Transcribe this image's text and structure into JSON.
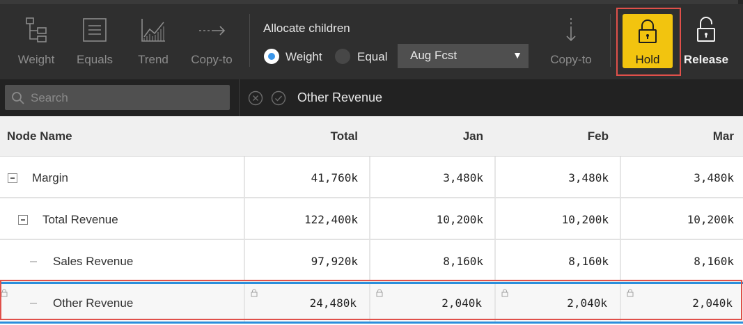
{
  "toolbar": {
    "buttons": [
      {
        "label": "Weight",
        "icon": "weight-tree-icon"
      },
      {
        "label": "Equals",
        "icon": "equals-icon"
      },
      {
        "label": "Trend",
        "icon": "trend-chart-icon"
      },
      {
        "label": "Copy-to",
        "icon": "arrow-right-icon"
      }
    ],
    "allocate_title": "Allocate children",
    "allocate_options": [
      {
        "label": "Weight",
        "selected": true
      },
      {
        "label": "Equal",
        "selected": false
      }
    ],
    "forecast_select": "Aug Fcst",
    "copy_to_down_label": "Copy-to",
    "hold_label": "Hold",
    "release_label": "Release",
    "colors": {
      "hold_bg": "#f2c40f",
      "highlight_border": "#e0504a",
      "selection": "#2b8fdc"
    }
  },
  "search": {
    "placeholder": "Search",
    "selected_node": "Other Revenue"
  },
  "grid": {
    "columns": [
      "Node Name",
      "Total",
      "Jan",
      "Feb",
      "Mar"
    ],
    "rows": [
      {
        "name": "Margin",
        "total": "41,760k",
        "jan": "3,480k",
        "feb": "3,480k",
        "mar": "3,480k"
      },
      {
        "name": "Total Revenue",
        "total": "122,400k",
        "jan": "10,200k",
        "feb": "10,200k",
        "mar": "10,200k"
      },
      {
        "name": "Sales Revenue",
        "total": "97,920k",
        "jan": "8,160k",
        "feb": "8,160k",
        "mar": "8,160k"
      },
      {
        "name": "Other Revenue",
        "total": "24,480k",
        "jan": "2,040k",
        "feb": "2,040k",
        "mar": "2,040k"
      }
    ]
  }
}
